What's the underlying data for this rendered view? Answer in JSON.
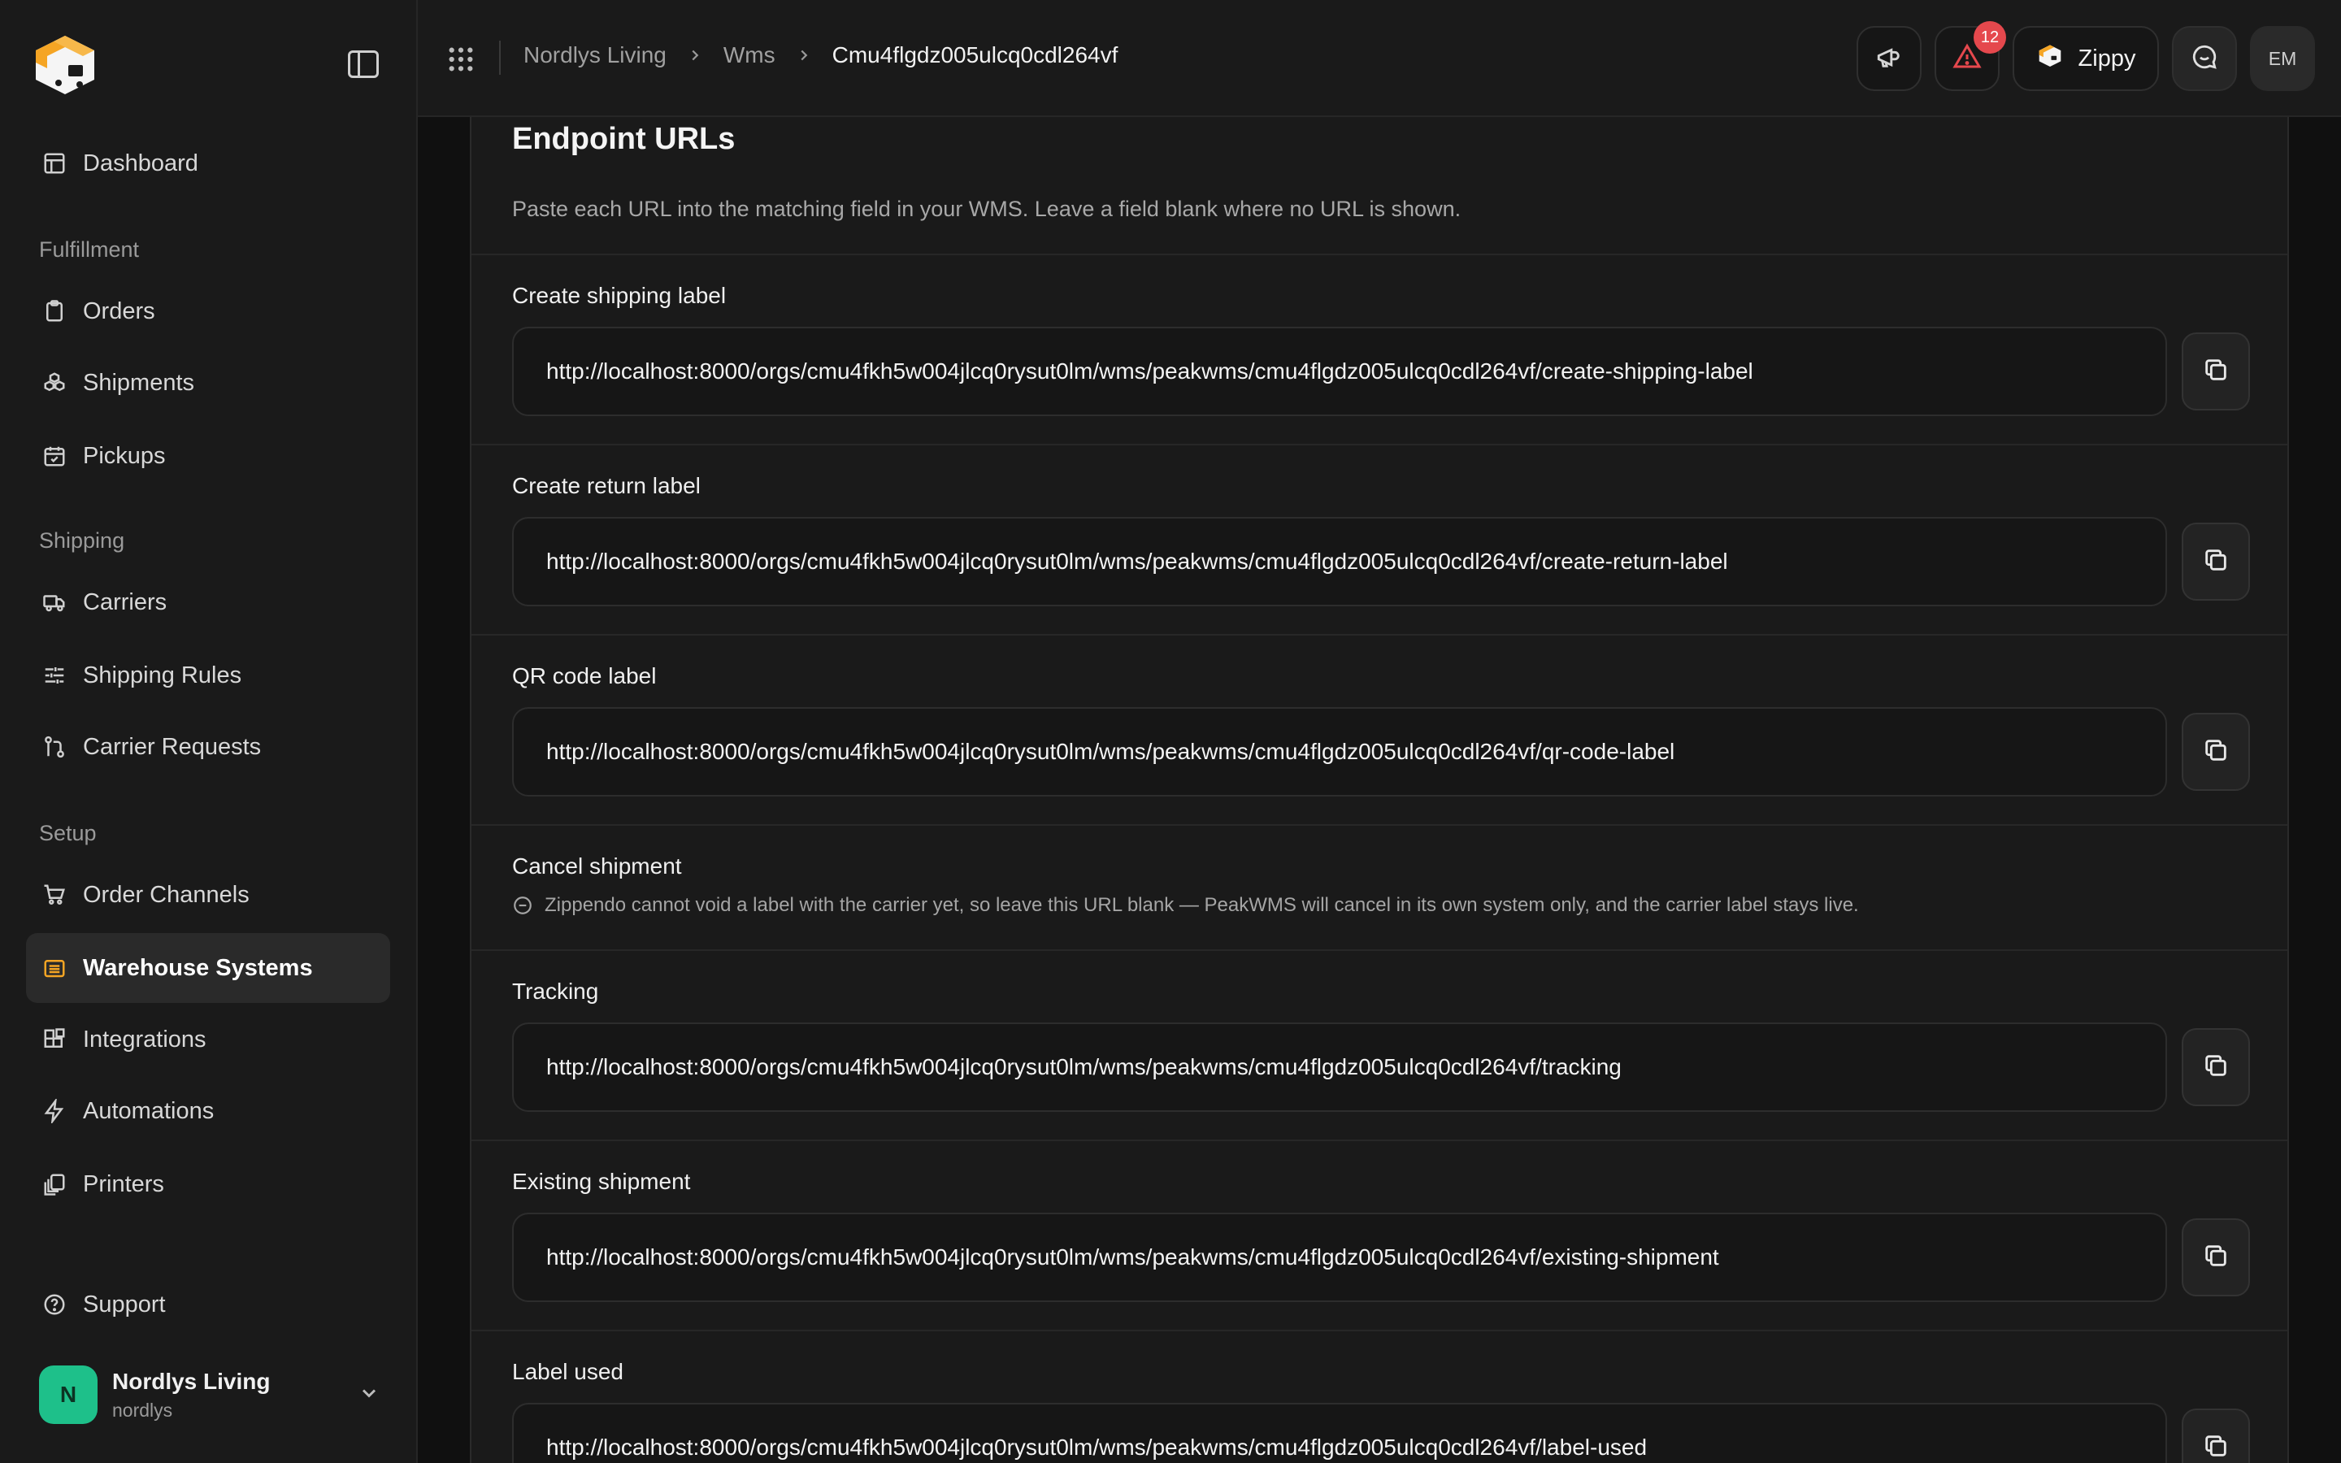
{
  "sidebar": {
    "nav": {
      "dashboard": "Dashboard",
      "fulfillment_section": "Fulfillment",
      "orders": "Orders",
      "shipments": "Shipments",
      "pickups": "Pickups",
      "shipping_section": "Shipping",
      "carriers": "Carriers",
      "shipping_rules": "Shipping Rules",
      "carrier_requests": "Carrier Requests",
      "setup_section": "Setup",
      "order_channels": "Order Channels",
      "warehouse_systems": "Warehouse Systems",
      "integrations": "Integrations",
      "automations": "Automations",
      "printers": "Printers",
      "support": "Support"
    },
    "active_item": "warehouse_systems",
    "accent_color": "#f5a524",
    "org": {
      "initial": "N",
      "name": "Nordlys Living",
      "slug": "nordlys",
      "avatar_color": "#1ec08a"
    }
  },
  "topbar": {
    "breadcrumb": [
      "Nordlys Living",
      "Wms",
      "Cmu4flgdz005ulcq0cdl264vf"
    ],
    "alerts_count": "12",
    "brand_button": "Zippy",
    "user_initials": "EM"
  },
  "card": {
    "title": "Endpoint URLs",
    "description": "Paste each URL into the matching field in your WMS. Leave a field blank where no URL is shown.",
    "sections": {
      "create_shipping_label": {
        "label": "Create shipping label",
        "url": "http://localhost:8000/orgs/cmu4fkh5w004jlcq0rysut0lm/wms/peakwms/cmu4flgdz005ulcq0cdl264vf/create-shipping-label"
      },
      "create_return_label": {
        "label": "Create return label",
        "url": "http://localhost:8000/orgs/cmu4fkh5w004jlcq0rysut0lm/wms/peakwms/cmu4flgdz005ulcq0cdl264vf/create-return-label"
      },
      "qr_code_label": {
        "label": "QR code label",
        "url": "http://localhost:8000/orgs/cmu4fkh5w004jlcq0rysut0lm/wms/peakwms/cmu4flgdz005ulcq0cdl264vf/qr-code-label"
      },
      "cancel_shipment": {
        "label": "Cancel shipment",
        "note": "Zippendo cannot void a label with the carrier yet, so leave this URL blank — PeakWMS will cancel in its own system only, and the carrier label stays live."
      },
      "tracking": {
        "label": "Tracking",
        "url": "http://localhost:8000/orgs/cmu4fkh5w004jlcq0rysut0lm/wms/peakwms/cmu4flgdz005ulcq0cdl264vf/tracking"
      },
      "existing_shipment": {
        "label": "Existing shipment",
        "url": "http://localhost:8000/orgs/cmu4fkh5w004jlcq0rysut0lm/wms/peakwms/cmu4flgdz005ulcq0cdl264vf/existing-shipment"
      },
      "label_used": {
        "label": "Label used",
        "url": "http://localhost:8000/orgs/cmu4fkh5w004jlcq0rysut0lm/wms/peakwms/cmu4flgdz005ulcq0cdl264vf/label-used"
      }
    }
  }
}
